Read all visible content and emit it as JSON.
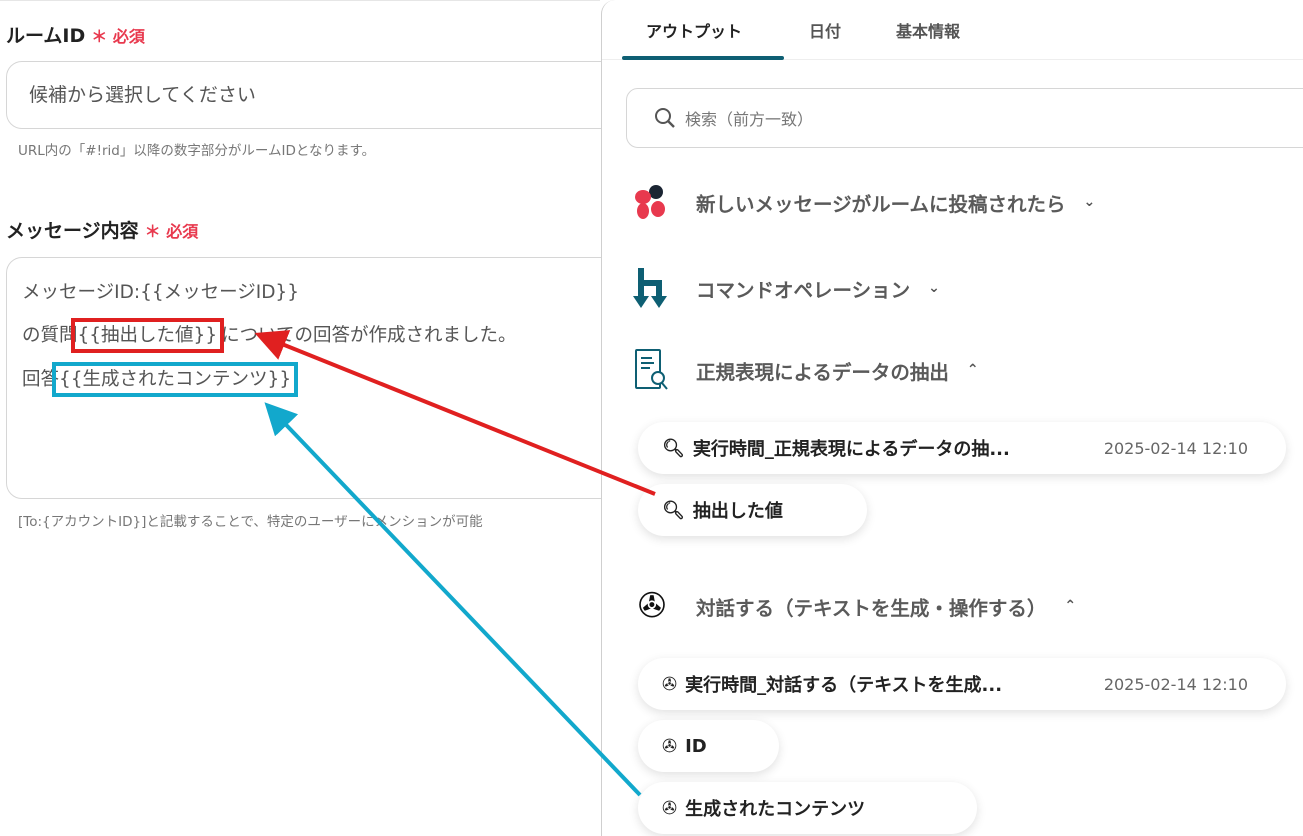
{
  "form": {
    "room_id": {
      "label": "ルームID",
      "required": "必須",
      "placeholder": "候補から選択してください",
      "help": "URL内の「#!rid」以降の数字部分がルームIDとなります。"
    },
    "message": {
      "label": "メッセージ内容",
      "required": "必須",
      "lines": [
        {
          "prefix": "メッセージID:{{メッセージID}}",
          "token": "",
          "suffix": ""
        },
        {
          "prefix": "の質問",
          "token": "{{抽出した値}}",
          "suffix": "についての回答が作成されました。"
        },
        {
          "prefix": "回答",
          "token": "{{生成されたコンテンツ}}",
          "suffix": ""
        }
      ],
      "help": "[To:{アカウントID}]と記載することで、特定のユーザーにメンションが可能"
    }
  },
  "panel": {
    "tabs": [
      {
        "label": "アウトプット",
        "active": true
      },
      {
        "label": "日付"
      },
      {
        "label": "基本情報"
      }
    ],
    "search_placeholder": "検索（前方一致）",
    "sections": [
      {
        "title": "新しいメッセージがルームに投稿されたら",
        "icon": "chatwork-icon",
        "expanded": false
      },
      {
        "title": "コマンドオペレーション",
        "icon": "command-operation-icon",
        "expanded": false
      },
      {
        "title": "正規表現によるデータの抽出",
        "icon": "regex-extract-icon",
        "expanded": true,
        "items": [
          {
            "label": "実行時間_正規表現によるデータの抽...",
            "time": "2025-02-14 12:10"
          },
          {
            "label": "抽出した値"
          }
        ]
      },
      {
        "title": "対話する（テキストを生成・操作する）",
        "icon": "openai-icon",
        "expanded": true,
        "items": [
          {
            "label": "実行時間_対話する（テキストを生成...",
            "time": "2025-02-14 12:10"
          },
          {
            "label": "ID"
          },
          {
            "label": "生成されたコンテンツ"
          }
        ]
      }
    ]
  },
  "colors": {
    "accent": "#0e5f73",
    "required": "#e8394e",
    "annotation_red": "#e02020",
    "annotation_blue": "#12a8cc"
  }
}
